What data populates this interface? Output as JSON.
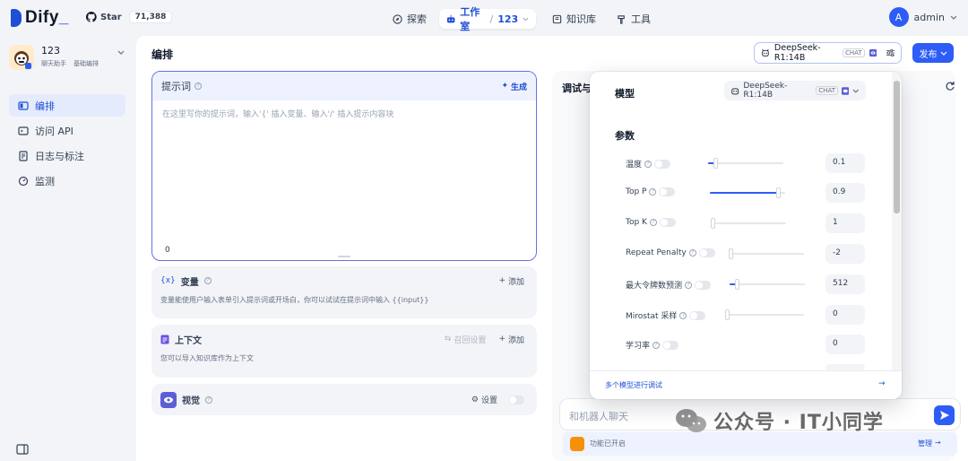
{
  "brand": {
    "name": "Dify",
    "github_label": "Star",
    "github_stars": "71,388"
  },
  "nav": {
    "explore": "探索",
    "studio": "工作室",
    "studio_app": "123",
    "knowledge": "知识库",
    "tools": "工具"
  },
  "user": {
    "initial": "A",
    "name": "admin"
  },
  "app": {
    "name": "123",
    "type": "聊天助手",
    "mode": "基础编排"
  },
  "sidebar": {
    "items": [
      {
        "label": "编排",
        "icon": "orchestrate-icon",
        "active": true
      },
      {
        "label": "访问 API",
        "icon": "api-icon",
        "active": false
      },
      {
        "label": "日志与标注",
        "icon": "logs-icon",
        "active": false
      },
      {
        "label": "监测",
        "icon": "monitor-icon",
        "active": false
      }
    ]
  },
  "main": {
    "title": "编排",
    "prompt": {
      "title": "提示词",
      "generate": "生成",
      "placeholder": "在这里写你的提示词，输入'{' 插入变量、输入'/' 插入提示内容块",
      "count": "0"
    },
    "variables": {
      "title": "变量",
      "add": "添加",
      "desc": "变量能使用户输入表单引入提示词或开场白，你可以试试在提示词中输入 {{input}}"
    },
    "context": {
      "title": "上下文",
      "recall": "召回设置",
      "add": "添加",
      "desc": "您可以导入知识库作为上下文"
    },
    "vision": {
      "title": "视觉",
      "settings": "设置"
    }
  },
  "debug": {
    "title": "调试与",
    "chat_placeholder": "和机器人聊天",
    "feature_text": "功能已开启",
    "manage": "管理"
  },
  "toolbar": {
    "model_name": "DeepSeek-R1:14B",
    "model_badge": "CHAT",
    "publish": "发布"
  },
  "model_popup": {
    "model_label": "模型",
    "model_name": "DeepSeek-R1:14B",
    "model_badge": "CHAT",
    "params_label": "参数",
    "params": [
      {
        "label": "温度",
        "value": "0.1",
        "slider": 0.1
      },
      {
        "label": "Top P",
        "value": "0.9",
        "slider": 0.9
      },
      {
        "label": "Top K",
        "value": "1",
        "slider": 0.0
      },
      {
        "label": "Repeat Penalty",
        "value": "-2",
        "slider": 0.0
      },
      {
        "label": "最大令牌数预测",
        "value": "512",
        "slider": 0.1
      },
      {
        "label": "Mirostat 采样",
        "value": "0",
        "slider": 0.0
      },
      {
        "label": "学习率",
        "value": "0",
        "slider": null
      }
    ],
    "multi_model": "多个模型进行调试",
    "multi_arrow": "→"
  },
  "watermark": "公众号 · IT小同学",
  "colors": {
    "accent": "#2d5cf6",
    "brand": "#1f4fd6",
    "prompt_border": "#6b6fe0"
  }
}
